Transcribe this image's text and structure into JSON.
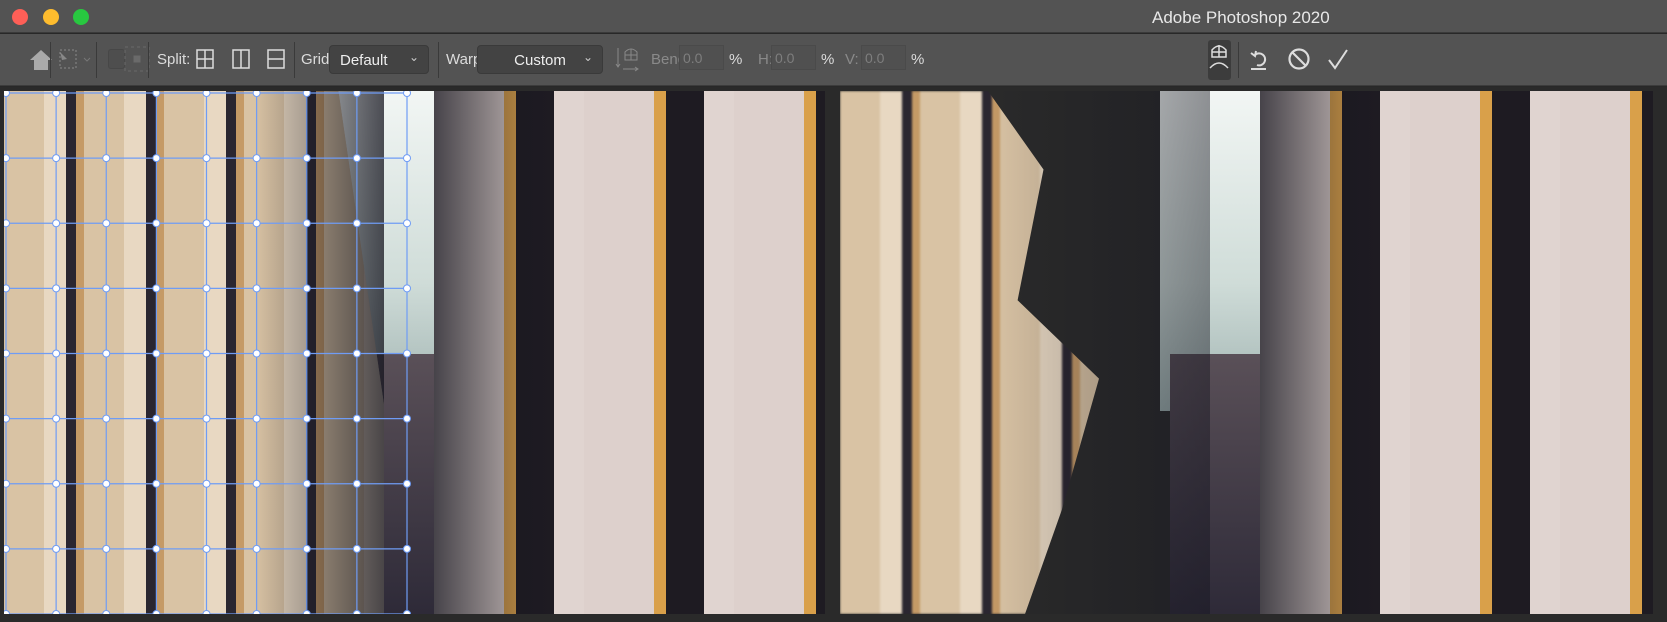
{
  "window": {
    "title": "Adobe Photoshop 2020",
    "traffic_lights": {
      "close": "#fe5f57",
      "minimize": "#febc2e",
      "zoom": "#28c840"
    }
  },
  "toolbar": {
    "home_icon": "home-icon",
    "split_label": "Split:",
    "grid_label": "Grid:",
    "grid_value": "Default",
    "warp_label": "Warp:",
    "warp_value": "Custom",
    "bend_label": "Bend:",
    "bend_value": "0.0",
    "h_label": "H:",
    "h_value": "0.0",
    "v_label": "V:",
    "v_value": "0.0",
    "percent": "%"
  },
  "grid_overlay": {
    "color": "#6f9cf5",
    "rows": 9,
    "cols": 9
  }
}
